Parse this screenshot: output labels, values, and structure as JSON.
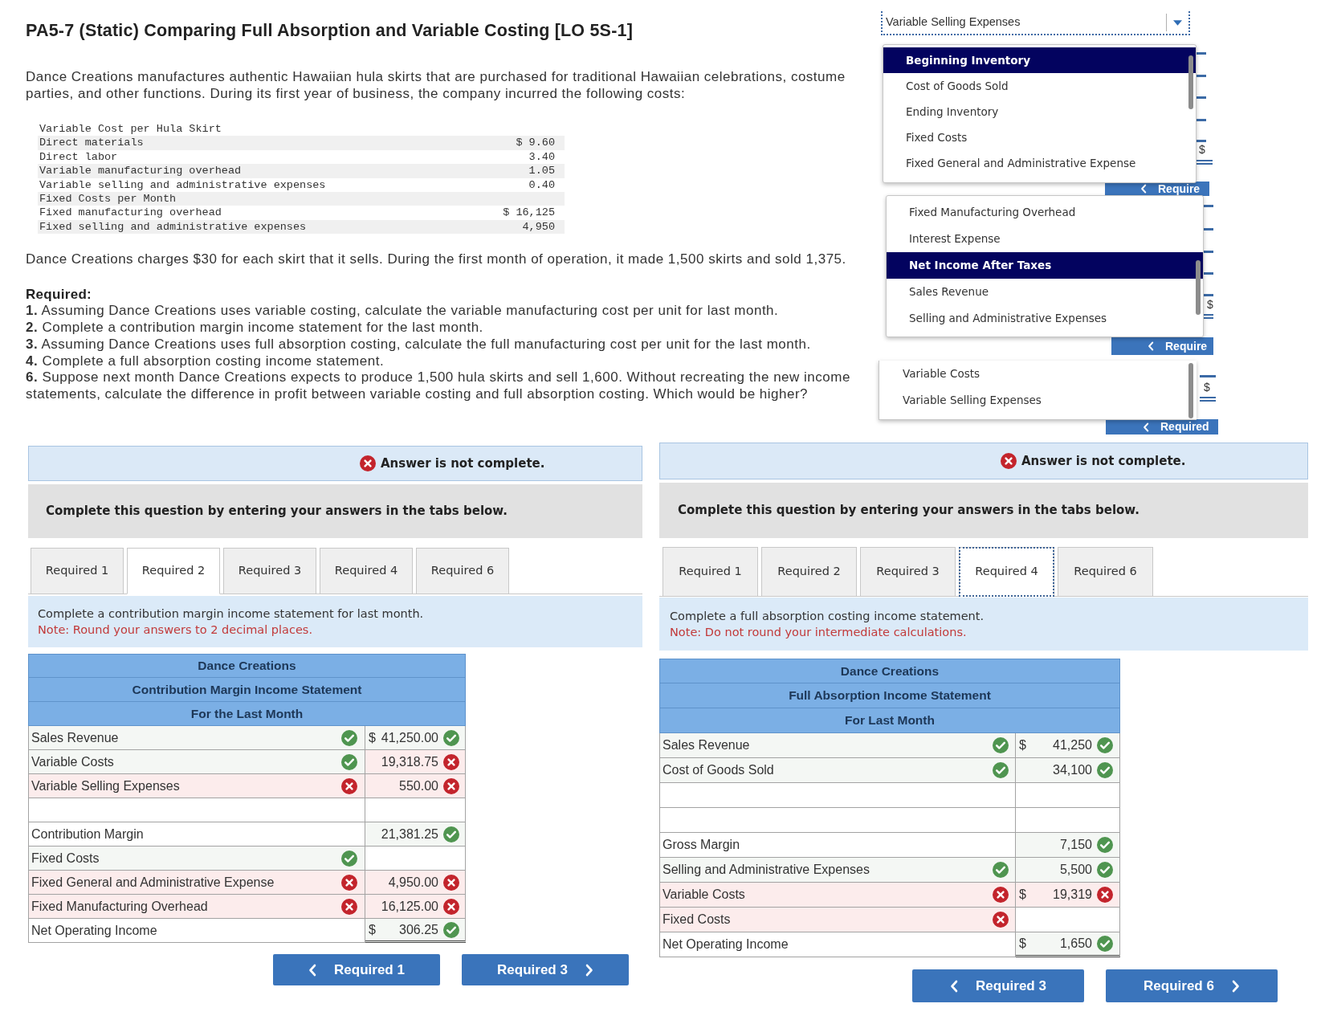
{
  "problem": {
    "title": "PA5-7 (Static) Comparing Full Absorption and Variable Costing [LO 5S-1]",
    "intro": "Dance Creations manufactures authentic Hawaiian hula skirts that are purchased for traditional Hawaiian celebrations, costume parties, and other functions. During its first year of business, the company incurred the following costs:",
    "cost_table": [
      {
        "label": "Variable Cost per Hula Skirt"
      },
      {
        "label": "Direct materials",
        "value": "$ 9.60"
      },
      {
        "label": "Direct labor",
        "value": "3.40"
      },
      {
        "label": "Variable manufacturing overhead",
        "value": "1.05"
      },
      {
        "label": "Variable selling and administrative expenses",
        "value": "0.40"
      },
      {
        "label": "Fixed Costs per Month"
      },
      {
        "label": "Fixed manufacturing overhead",
        "value": "$ 16,125"
      },
      {
        "label": "Fixed selling and administrative expenses",
        "value": "4,950"
      }
    ],
    "pricing": "Dance Creations charges $30 for each skirt that it sells. During the first month of operation, it made 1,500 skirts and sold 1,375.",
    "required_heading": "Required:",
    "required_items": [
      "**1.** Assuming Dance Creations uses variable costing, calculate the variable manufacturing cost per unit for last month.",
      "**2.** Complete a contribution margin income statement for the last month.",
      "**3.** Assuming Dance Creations uses full absorption costing, calculate the full manufacturing cost per unit for the last month.",
      "**4.** Complete a full absorption costing income statement.",
      "**6.** Suppose next month Dance Creations expects to produce 1,500 hula skirts and sell 1,600. Without recreating the new income statements, calculate the difference in profit between variable costing and full absorption costing. Which would be higher?"
    ]
  },
  "dropdown": {
    "value": "Variable Selling Expenses",
    "lists": [
      {
        "options": [
          {
            "text": "Beginning Inventory",
            "selected": true
          },
          {
            "text": "Cost of Goods Sold",
            "selected": false
          },
          {
            "text": "Ending Inventory",
            "selected": false
          },
          {
            "text": "Fixed Costs",
            "selected": false
          },
          {
            "text": "Fixed General and Administrative Expense",
            "selected": false
          }
        ]
      },
      {
        "options": [
          {
            "text": "Fixed Manufacturing Overhead",
            "selected": false
          },
          {
            "text": "Interest Expense",
            "selected": false
          },
          {
            "text": "Net Income After Taxes",
            "selected": true
          },
          {
            "text": "Sales Revenue",
            "selected": false
          },
          {
            "text": "Selling and Administrative Expenses",
            "selected": false
          }
        ]
      },
      {
        "options": [
          {
            "text": "Variable Costs",
            "selected": false
          },
          {
            "text": "Variable Selling Expenses",
            "selected": false
          }
        ]
      }
    ]
  },
  "background_fragments": {
    "buttons": [
      "Require",
      "Require",
      "Required"
    ],
    "currency_marks": [
      "$",
      "$",
      "$"
    ]
  },
  "panels": [
    {
      "status": {
        "correct": false,
        "text": "Answer is not complete."
      },
      "prompt": "Complete this question by entering your answers in the tabs below.",
      "tabs": [
        {
          "label": "Required 1",
          "selected": false,
          "focused": false
        },
        {
          "label": "Required 2",
          "selected": true,
          "focused": false
        },
        {
          "label": "Required 3",
          "selected": false,
          "focused": false
        },
        {
          "label": "Required 4",
          "selected": false,
          "focused": false
        },
        {
          "label": "Required 6",
          "selected": false,
          "focused": false
        }
      ],
      "task": "Complete a contribution margin income statement for last month.",
      "note": "Note: Round your answers to 2 decimal places.",
      "statement": {
        "header": [
          "Dance Creations",
          "Contribution Margin Income Statement",
          "For the Last Month"
        ],
        "rows": [
          {
            "label": "Sales Revenue",
            "label_check": {
              "correct": true
            },
            "currency": "$",
            "value": "41,250.00",
            "value_check": {
              "correct": true
            },
            "double_underline": false
          },
          {
            "label": "Variable Costs",
            "label_check": {
              "correct": true
            },
            "value": "19,318.75",
            "value_check": {
              "correct": false
            },
            "double_underline": false
          },
          {
            "label": "Variable Selling Expenses",
            "label_check": {
              "correct": false
            },
            "value": "550.00",
            "value_check": {
              "correct": false
            },
            "double_underline": false
          },
          {
            "double_underline": false
          },
          {
            "label": "Contribution Margin",
            "value": "21,381.25",
            "value_check": {
              "correct": true
            },
            "double_underline": false
          },
          {
            "label": "Fixed Costs",
            "label_check": {
              "correct": true
            },
            "double_underline": false
          },
          {
            "label": "Fixed General and Administrative Expense",
            "label_check": {
              "correct": false
            },
            "value": "4,950.00",
            "value_check": {
              "correct": false
            },
            "double_underline": false
          },
          {
            "label": "Fixed Manufacturing Overhead",
            "label_check": {
              "correct": false
            },
            "value": "16,125.00",
            "value_check": {
              "correct": false
            },
            "double_underline": false
          },
          {
            "label": "Net Operating Income",
            "currency": "$",
            "value": "306.25",
            "value_check": {
              "correct": true
            },
            "double_underline": true
          }
        ]
      },
      "nav": [
        {
          "label": "Required 1",
          "kind": "prev"
        },
        {
          "label": "Required 3",
          "kind": "next"
        }
      ]
    },
    {
      "status": {
        "correct": false,
        "text": "Answer is not complete."
      },
      "prompt": "Complete this question by entering your answers in the tabs below.",
      "tabs": [
        {
          "label": "Required 1",
          "selected": false,
          "focused": false
        },
        {
          "label": "Required 2",
          "selected": false,
          "focused": false
        },
        {
          "label": "Required 3",
          "selected": false,
          "focused": false
        },
        {
          "label": "Required 4",
          "selected": true,
          "focused": true
        },
        {
          "label": "Required 6",
          "selected": false,
          "focused": false
        }
      ],
      "task": "Complete a full absorption costing income statement.",
      "note": "Note: Do not round your intermediate calculations.",
      "statement": {
        "header": [
          "Dance Creations",
          "Full Absorption Income Statement",
          "For Last Month"
        ],
        "rows": [
          {
            "label": "Sales Revenue",
            "label_check": {
              "correct": true
            },
            "currency": "$",
            "value": "41,250",
            "value_check": {
              "correct": true
            },
            "double_underline": false
          },
          {
            "label": "Cost of Goods Sold",
            "label_check": {
              "correct": true
            },
            "value": "34,100",
            "value_check": {
              "correct": true
            },
            "double_underline": false
          },
          {
            "double_underline": false
          },
          {
            "double_underline": false
          },
          {
            "label": "Gross Margin",
            "value": "7,150",
            "value_check": {
              "correct": true
            },
            "double_underline": false
          },
          {
            "label": "Selling and Administrative Expenses",
            "label_check": {
              "correct": true
            },
            "value": "5,500",
            "value_check": {
              "correct": true
            },
            "double_underline": false
          },
          {
            "label": "Variable Costs",
            "label_check": {
              "correct": false
            },
            "currency": "$",
            "value": "19,319",
            "value_check": {
              "correct": false
            },
            "double_underline": false
          },
          {
            "label": "Fixed Costs",
            "label_check": {
              "correct": false
            },
            "double_underline": false
          },
          {
            "label": "Net Operating Income",
            "currency": "$",
            "value": "1,650",
            "value_check": {
              "correct": true
            },
            "double_underline": true
          }
        ]
      },
      "nav": [
        {
          "label": "Required 3",
          "kind": "prev"
        },
        {
          "label": "Required 6",
          "kind": "next"
        }
      ]
    }
  ]
}
